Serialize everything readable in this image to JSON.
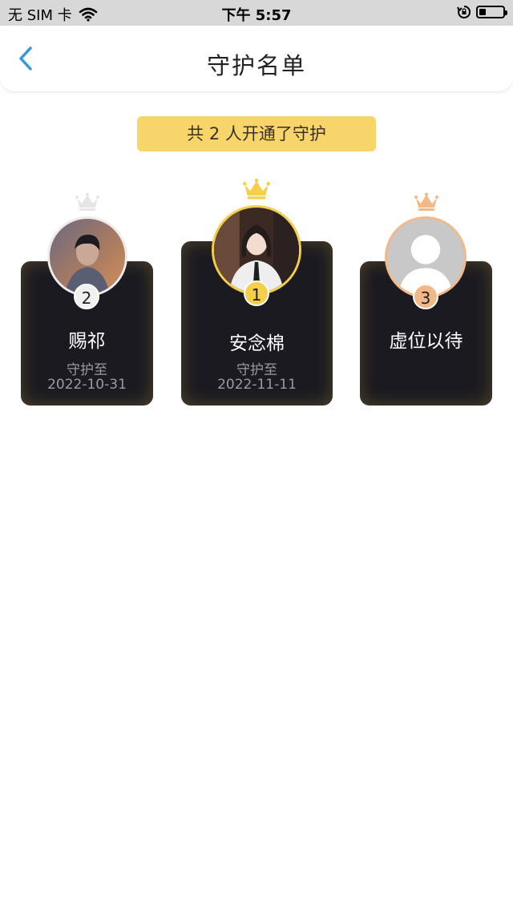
{
  "status_bar": {
    "carrier": "无 SIM 卡",
    "time": "下午 5:57"
  },
  "nav": {
    "title": "守护名单",
    "back_icon": "chevron-left-icon"
  },
  "summary": {
    "text": "共 2 人开通了守护"
  },
  "colors": {
    "gold": "#f6cf4a",
    "silver": "#ececec",
    "bronze": "#f3b888",
    "card_bg": "#1b1a20",
    "back_blue": "#2f9ae0"
  },
  "guardians": [
    {
      "rank": "1",
      "name": "安念棉",
      "label": "守护至",
      "date": "2022-11-11"
    },
    {
      "rank": "2",
      "name": "赐祁",
      "label": "守护至",
      "date": "2022-10-31"
    },
    {
      "rank": "3",
      "name": "虚位以待"
    }
  ]
}
